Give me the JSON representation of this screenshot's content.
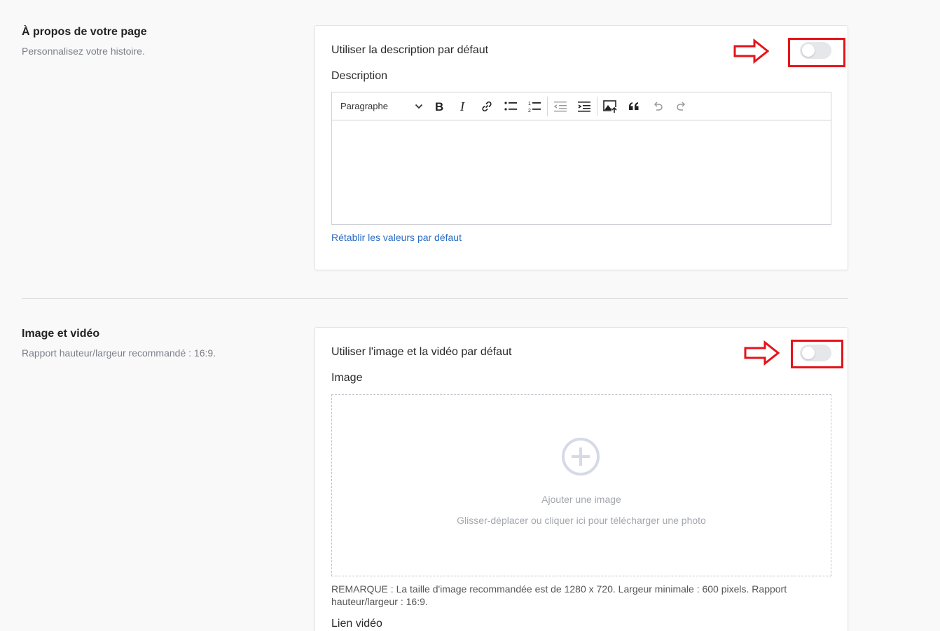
{
  "about": {
    "title": "À propos de votre page",
    "subtitle": "Personnalisez votre histoire.",
    "toggle_label": "Utiliser la description par défaut",
    "toggle_on": false,
    "description_label": "Description",
    "toolbar": {
      "paragraph_select": "Paragraphe",
      "icons": [
        "bold-icon",
        "italic-icon",
        "link-icon",
        "bulleted-list-icon",
        "numbered-list-icon",
        "outdent-icon",
        "indent-icon",
        "insert-image-icon",
        "blockquote-icon",
        "undo-icon",
        "redo-icon"
      ]
    },
    "reset_link": "Rétablir les valeurs par défaut"
  },
  "media": {
    "title": "Image et vidéo",
    "subtitle": "Rapport hauteur/largeur recommandé : 16:9.",
    "toggle_label": "Utiliser l'image et la vidéo par défaut",
    "toggle_on": false,
    "image_label": "Image",
    "dropzone": {
      "title": "Ajouter une image",
      "hint": "Glisser-déplacer ou cliquer ici pour télécharger une photo"
    },
    "note": "REMARQUE : La taille d'image recommandée est de 1280 x 720. Largeur minimale : 600 pixels. Rapport hauteur/largeur : 16:9.",
    "video_label": "Lien vidéo"
  },
  "colors": {
    "highlight": "#e5141a",
    "link": "#2b6cc4",
    "toggle_off": "#e6e7ea"
  }
}
